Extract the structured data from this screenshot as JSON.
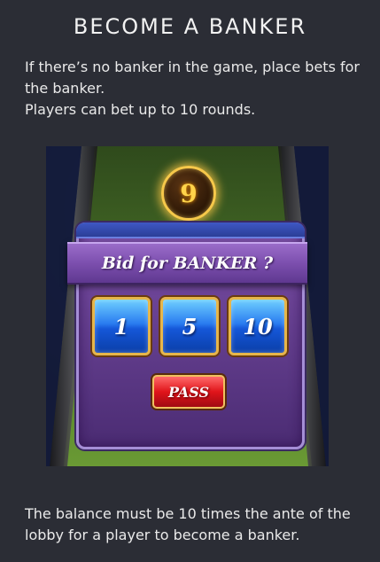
{
  "header": {
    "title": "BECOME A BANKER"
  },
  "intro": {
    "line1": "If there’s no banker in the game, place bets for the banker.",
    "line2": "Players can bet up to 10 rounds."
  },
  "game": {
    "countdown": "9",
    "prompt": "Bid for BANKER ?",
    "bid_options": [
      "1",
      "5",
      "10"
    ],
    "pass_label": "PASS",
    "colors": {
      "panel": "#6a449a",
      "bid_button": "#1f66e0",
      "pass_button": "#d8121a",
      "felt": "#4f7a2a",
      "gold": "#f6c84a"
    }
  },
  "footer": {
    "text": "The balance must be 10 times the ante of the lobby for a player to become a banker."
  }
}
